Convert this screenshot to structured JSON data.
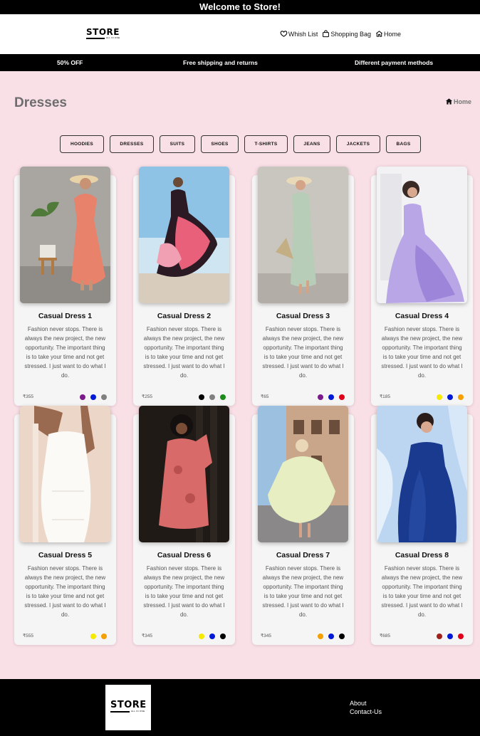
{
  "topbar": {
    "text": "Welcome to Store!"
  },
  "brand": {
    "name": "STORE",
    "tagline": "ALL IN ONE"
  },
  "nav": {
    "wishlist": "Whish List",
    "bag": "Shopping Bag",
    "home": "Home"
  },
  "promo": {
    "items": [
      "50% OFF",
      "Free shipping and returns",
      "Different payment methods"
    ]
  },
  "page": {
    "title": "Dresses",
    "breadcrumb": "Home"
  },
  "categories": [
    "HOODIES",
    "DRESSES",
    "SUITS",
    "SHOES",
    "T-SHIRTS",
    "JEANS",
    "JACKETS",
    "BAGS"
  ],
  "products": [
    {
      "name": "Casual Dress 1",
      "description": "Fashion never stops. There is always the new project, the new opportunity. The important thing is to take your time and not get stressed. I just want to do what I do.",
      "price": "₹355",
      "colors": [
        "#7b1a8a",
        "#0019d6",
        "#808080"
      ]
    },
    {
      "name": "Casual Dress 2",
      "description": "Fashion never stops. There is always the new project, the new opportunity. The important thing is to take your time and not get stressed. I just want to do what I do.",
      "price": "₹255",
      "colors": [
        "#000000",
        "#808080",
        "#1a8a1a"
      ]
    },
    {
      "name": "Casual Dress 3",
      "description": "Fashion never stops. There is always the new project, the new opportunity. The important thing is to take your time and not get stressed. I just want to do what I do.",
      "price": "₹65",
      "colors": [
        "#7b1a8a",
        "#0019d6",
        "#e0001a"
      ]
    },
    {
      "name": "Casual Dress 4",
      "description": "Fashion never stops. There is always the new project, the new opportunity. The important thing is to take your time and not get stressed. I just want to do what I do.",
      "price": "₹185",
      "colors": [
        "#f5ea00",
        "#0019d6",
        "#f5a000"
      ]
    },
    {
      "name": "Casual Dress 5",
      "description": "Fashion never stops. There is always the new project, the new opportunity. The important thing is to take your time and not get stressed. I just want to do what I do.",
      "price": "₹555",
      "colors": [
        "#f5ea00",
        "#f5a000"
      ]
    },
    {
      "name": "Casual Dress 6",
      "description": "Fashion never stops. There is always the new project, the new opportunity. The important thing is to take your time and not get stressed. I just want to do what I do.",
      "price": "₹345",
      "colors": [
        "#f5ea00",
        "#0019d6",
        "#000000"
      ]
    },
    {
      "name": "Casual Dress 7",
      "description": "Fashion never stops. There is always the new project, the new opportunity. The important thing is to take your time and not get stressed. I just want to do what I do.",
      "price": "₹345",
      "colors": [
        "#f5a000",
        "#0019d6",
        "#000000"
      ]
    },
    {
      "name": "Casual Dress 8",
      "description": "Fashion never stops. There is always the new project, the new opportunity. The important thing is to take your time and not get stressed. I just want to do what I do.",
      "price": "₹685",
      "colors": [
        "#a0201a",
        "#0019d6",
        "#e0001a"
      ]
    }
  ],
  "footer": {
    "links": [
      "About",
      "Contact-Us"
    ]
  }
}
